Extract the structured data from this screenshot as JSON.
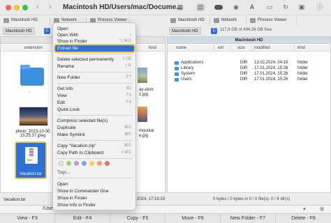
{
  "title_bar": {
    "title": "Macintosh HD/Users/mac/Docume...",
    "back": "‹",
    "forward": "›"
  },
  "toolbar": {
    "icons": [
      "grid-icon",
      "list-icon",
      "toggle-icon",
      "eye-icon",
      "font-icon",
      "compare-icon",
      "sync-icon",
      "terminal-icon",
      "info-icon"
    ]
  },
  "tabs": {
    "left": [
      "Macintosh HD",
      "Network",
      "Process Viewer"
    ],
    "right": [
      "Macintosh HD",
      "Network",
      "Process Viewer"
    ]
  },
  "address": {
    "left_disk": "Macintosh HD",
    "right_disk": "Macintosh HD",
    "right_free": "117,6 GB of 494,38 GB free"
  },
  "left_panel": {
    "columns": [
      "extension",
      "kind"
    ],
    "items": [
      {
        "label": ".."
      },
      {
        "label": "photo_2023-10-30 15.25.37.jpeg"
      },
      {
        "label": "Vacation.tar",
        "tag": "TAR"
      },
      {
        "label": "ay-picni",
        "sub": "1.jpg"
      },
      {
        "label": "mountai",
        "sub": "e.jpg"
      }
    ],
    "status": "Vacation.tar",
    "mid_status": "2024, 17:18:33"
  },
  "right_panel": {
    "path": "Macintosh HD",
    "columns": [
      "name",
      "ext",
      "size",
      "modified",
      "kind"
    ],
    "rows": [
      {
        "name": "Applications",
        "size": "DIR",
        "modified": "13.02.2024, 04:19",
        "kind": "folder"
      },
      {
        "name": "Library",
        "size": "DIR",
        "modified": "17.01.2024, 15:26",
        "kind": "folder"
      },
      {
        "name": "System",
        "size": "DIR",
        "modified": "17.01.2024, 15:26",
        "kind": "folder"
      },
      {
        "name": "Users",
        "size": "DIR",
        "modified": "17.01.2024, 15:26",
        "kind": "folder"
      }
    ],
    "status": "0 bytes / 0 bytes in 0 / 0 file(s). 0 / 4 dir(s)"
  },
  "command_line": {
    "prompt": "/Use"
  },
  "fkeys": [
    "View - F3",
    "Edit - F4",
    "Copy - F5",
    "Move - F6",
    "New Folder - F7",
    "Delete - F8"
  ],
  "context_menu": {
    "items": [
      {
        "label": "Open",
        "shortcut": ""
      },
      {
        "label": "Open With",
        "shortcut": "›"
      },
      {
        "label": "Show in Finder",
        "shortcut": "⌥⌘O"
      },
      {
        "label": "Extract file",
        "shortcut": ""
      },
      {
        "label": "Delete selected permanently",
        "shortcut": "⇧⌫"
      },
      {
        "label": "Rename",
        "shortcut": "⇧R"
      },
      {
        "label": "New Folder",
        "shortcut": "F7"
      },
      {
        "label": "Get Info",
        "shortcut": "⌘I"
      },
      {
        "label": "View",
        "shortcut": "F3"
      },
      {
        "label": "Edit",
        "shortcut": "F4"
      },
      {
        "label": "Quick Look",
        "shortcut": ""
      },
      {
        "label": "Compress selected file(s)",
        "shortcut": ""
      },
      {
        "label": "Duplicate",
        "shortcut": "⌘D"
      },
      {
        "label": "Make Symlink",
        "shortcut": "⌘K"
      },
      {
        "label": "Copy \"Vacation.zip\"",
        "shortcut": "⌘C"
      },
      {
        "label": "Copy Path to Clipboard",
        "shortcut": "⇧⌘C"
      },
      {
        "label": "Tags...",
        "shortcut": ""
      },
      {
        "label": "Open",
        "shortcut": ""
      },
      {
        "label": "Show in Commander One",
        "shortcut": ""
      },
      {
        "label": "Show in Finder",
        "shortcut": ""
      },
      {
        "label": "Show Info in Finder",
        "shortcut": ""
      }
    ],
    "tag_colors": [
      "#e8e8e8",
      "#a0d468",
      "#c78fe0",
      "#6fa8f0",
      "#f3d35a",
      "#f5a35a",
      "#ef6a6a"
    ]
  }
}
